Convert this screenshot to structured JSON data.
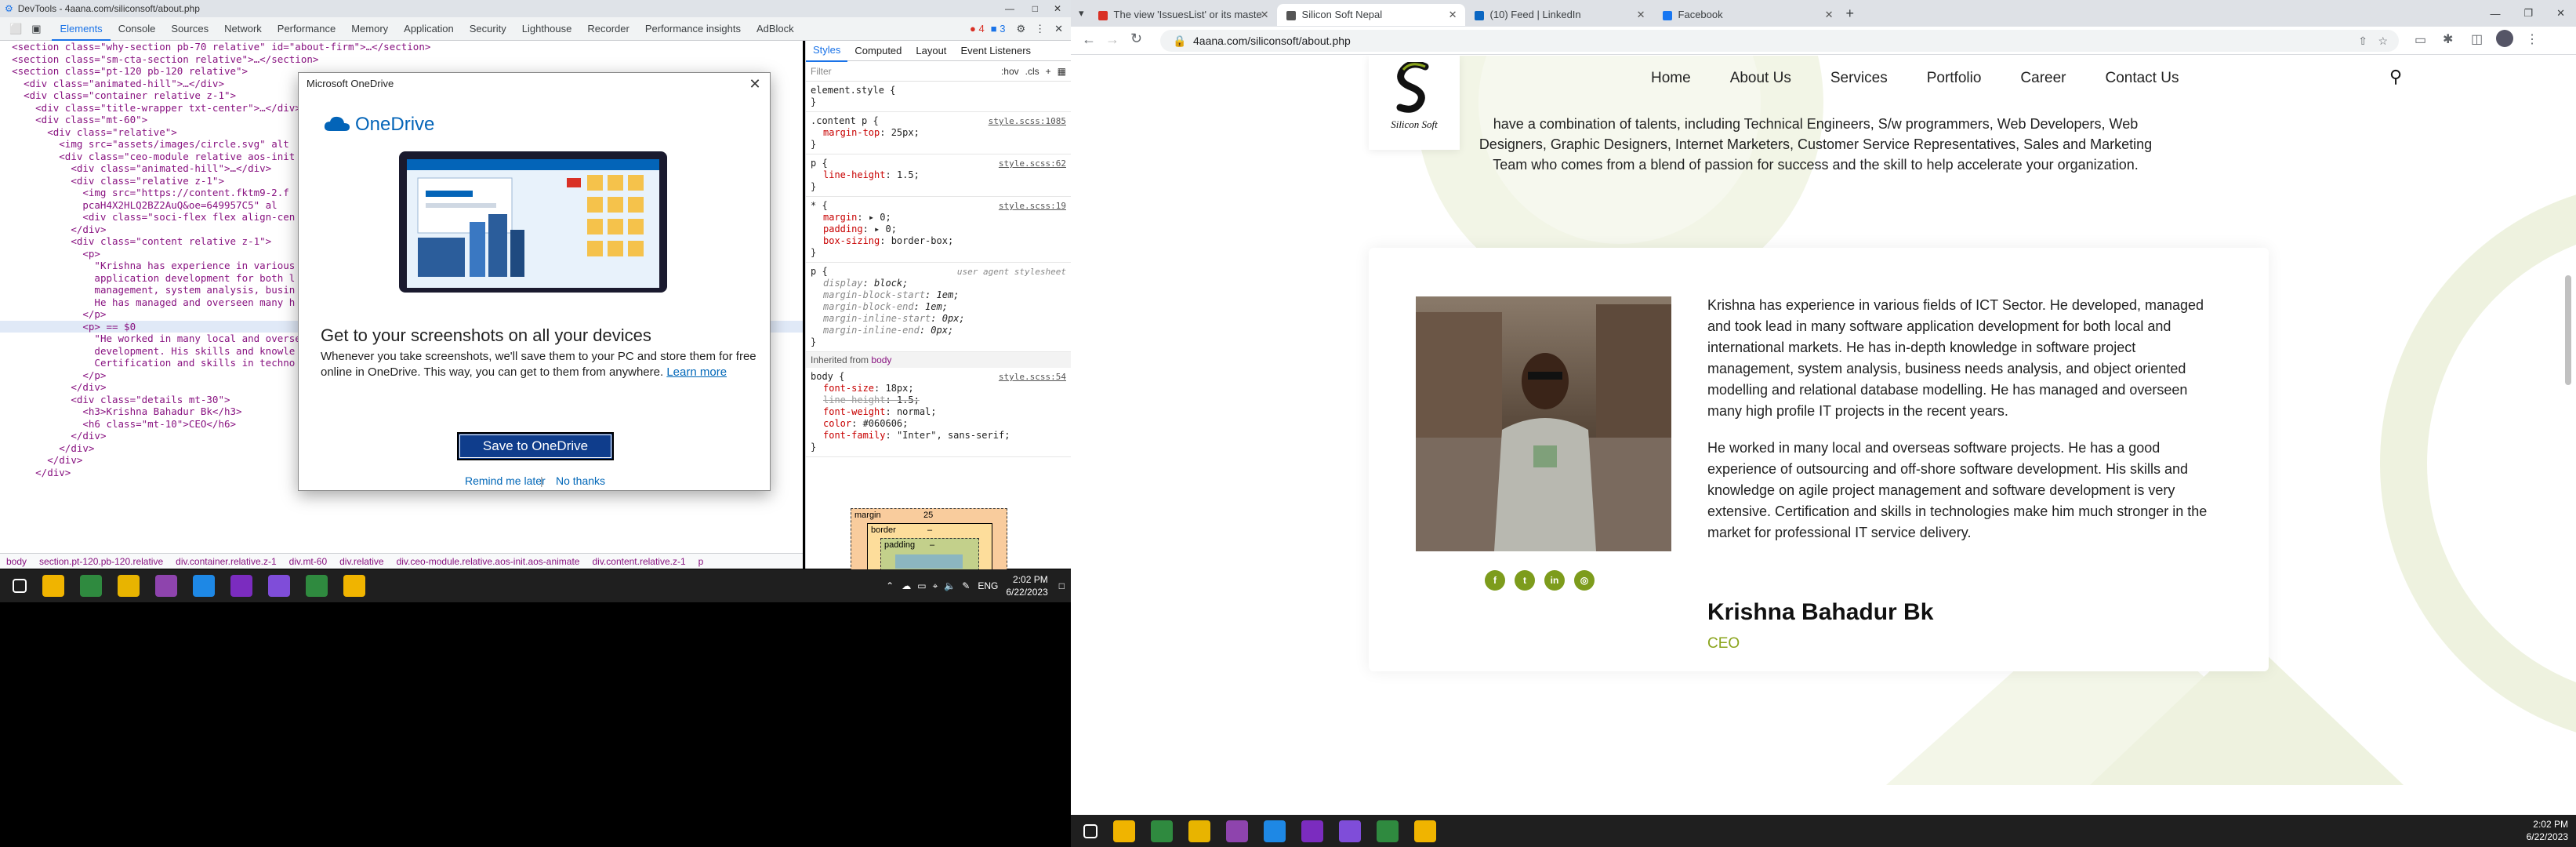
{
  "devtools": {
    "window_title": "DevTools - 4aana.com/siliconsoft/about.php",
    "tabs": [
      "Elements",
      "Console",
      "Sources",
      "Network",
      "Performance",
      "Memory",
      "Application",
      "Security",
      "Lighthouse",
      "Recorder",
      "Performance insights",
      "AdBlock"
    ],
    "active_tab": "Elements",
    "error_count": "4",
    "warning_count": "3",
    "dom_lines": [
      {
        "indent": 1,
        "text": "<section class=\"why-section pb-70 relative\" id=\"about-firm\">…</section>"
      },
      {
        "indent": 1,
        "text": "<section class=\"sm-cta-section relative\">…</section>"
      },
      {
        "indent": 1,
        "text": "<section class=\"pt-120 pb-120 relative\">"
      },
      {
        "indent": 2,
        "text": "<div class=\"animated-hill\">…</div>"
      },
      {
        "indent": 2,
        "text": "<div class=\"container relative z-1\">"
      },
      {
        "indent": 3,
        "text": "<div class=\"title-wrapper txt-center\">…</div>"
      },
      {
        "indent": 3,
        "text": "<div class=\"mt-60\">"
      },
      {
        "indent": 4,
        "text": "<div class=\"relative\">"
      },
      {
        "indent": 5,
        "text": "<img src=\"assets/images/circle.svg\" alt"
      },
      {
        "indent": 5,
        "text": "<div class=\"ceo-module relative aos-init"
      },
      {
        "indent": 6,
        "text": "<div class=\"animated-hill\">…</div>"
      },
      {
        "indent": 6,
        "text": "<div class=\"relative z-1\">"
      },
      {
        "indent": 7,
        "text": "<img src=\"https://content.fktm9-2.f"
      },
      {
        "indent": 7,
        "text": "pcaH4X2HLQ2BZ2AuQ&oe=649957C5\" al"
      },
      {
        "indent": 7,
        "text": "<div class=\"soci-flex flex align-cen"
      },
      {
        "indent": 6,
        "text": "</div>"
      },
      {
        "indent": 6,
        "text": "<div class=\"content relative z-1\">"
      },
      {
        "indent": 7,
        "text": "<p>"
      },
      {
        "indent": 8,
        "text": "\"Krishna has experience in various"
      },
      {
        "indent": 8,
        "text": "application development for both l"
      },
      {
        "indent": 8,
        "text": "management, system analysis, busin"
      },
      {
        "indent": 8,
        "text": "He has managed and overseen many h"
      },
      {
        "indent": 7,
        "text": "</p>"
      },
      {
        "indent": 7,
        "text": "<p> == $0",
        "selected": true
      },
      {
        "indent": 8,
        "text": "\"He worked in many local and overse"
      },
      {
        "indent": 8,
        "text": "development. His skills and knowle"
      },
      {
        "indent": 8,
        "text": "Certification and skills in techno"
      },
      {
        "indent": 7,
        "text": "</p>"
      },
      {
        "indent": 6,
        "text": "</div>"
      },
      {
        "indent": 6,
        "text": "<div class=\"details mt-30\">"
      },
      {
        "indent": 7,
        "text": "<h3>Krishna Bahadur Bk</h3>"
      },
      {
        "indent": 7,
        "text": "<h6 class=\"mt-10\">CEO</h6>"
      },
      {
        "indent": 6,
        "text": "</div>"
      },
      {
        "indent": 5,
        "text": "</div>"
      },
      {
        "indent": 4,
        "text": "</div>"
      },
      {
        "indent": 3,
        "text": "</div>"
      }
    ],
    "breadcrumbs": [
      "body",
      "section.pt-120.pb-120.relative",
      "div.container.relative.z-1",
      "div.mt-60",
      "div.relative",
      "div.ceo-module.relative.aos-init.aos-animate",
      "div.content.relative.z-1",
      "p"
    ],
    "styles_tabs": [
      "Styles",
      "Computed",
      "Layout",
      "Event Listeners"
    ],
    "filter_placeholder": "Filter",
    "filter_toggles": [
      ":hov",
      ".cls"
    ],
    "rules": [
      {
        "selector": "element.style {",
        "source": "",
        "props": []
      },
      {
        "selector": ".content p {",
        "source": "style.scss:1085",
        "props": [
          {
            "name": "margin-top",
            "value": "25px"
          }
        ]
      },
      {
        "selector": "p {",
        "source": "style.scss:62",
        "props": [
          {
            "name": "line-height",
            "value": "1.5"
          }
        ]
      },
      {
        "selector": "* {",
        "source": "style.scss:19",
        "props": [
          {
            "name": "margin",
            "value": "▸ 0"
          },
          {
            "name": "padding",
            "value": "▸ 0"
          },
          {
            "name": "box-sizing",
            "value": "border-box"
          }
        ]
      },
      {
        "selector": "p {",
        "source": "user agent stylesheet",
        "ua": true,
        "props": [
          {
            "name": "display",
            "value": "block"
          },
          {
            "name": "margin-block-start",
            "value": "1em"
          },
          {
            "name": "margin-block-end",
            "value": "1em"
          },
          {
            "name": "margin-inline-start",
            "value": "0px"
          },
          {
            "name": "margin-inline-end",
            "value": "0px"
          }
        ]
      }
    ],
    "inherited_label": "Inherited from",
    "inherited_from": "body",
    "body_rule": {
      "selector": "body {",
      "source": "style.scss:54",
      "props": [
        {
          "name": "font-size",
          "value": "18px"
        },
        {
          "name": "line-height",
          "value": "1.5",
          "strike": true
        },
        {
          "name": "font-weight",
          "value": "normal"
        },
        {
          "name": "color",
          "value": "#060606"
        },
        {
          "name": "font-family",
          "value": "\"Inter\", sans-serif"
        }
      ]
    },
    "boxmodel": {
      "margin_label": "margin",
      "margin_value": "25",
      "border_label": "border",
      "border_value": "–",
      "padding_label": "padding",
      "padding_value": "–"
    }
  },
  "onedrive": {
    "title": "Microsoft OneDrive",
    "brand": "OneDrive",
    "heading": "Get to your screenshots on all your devices",
    "description": "Whenever you take screenshots, we'll save them to your PC and store them for free online in OneDrive. This way, you can get to them from anywhere.",
    "learn_more": "Learn more",
    "save_button": "Save to OneDrive",
    "remind_later": "Remind me later",
    "separator": "|",
    "no_thanks": "No thanks"
  },
  "left_taskbar": {
    "icons": [
      "windows-start",
      "file-explorer",
      "chrome",
      "sticky-notes",
      "visual-studio",
      "vscode",
      "visual-studio-purple",
      "viber",
      "chrome-2",
      "snip"
    ],
    "lang": "ENG",
    "time": "2:02 PM",
    "date": "6/22/2023"
  },
  "browser": {
    "tabs": [
      {
        "title": "The view 'IssuesList' or its maste",
        "icon": "error"
      },
      {
        "title": "Silicon Soft Nepal",
        "icon": "site",
        "active": true
      },
      {
        "title": "(10) Feed | LinkedIn",
        "icon": "linkedin"
      },
      {
        "title": "Facebook",
        "icon": "facebook"
      }
    ],
    "url": "4aana.com/siliconsoft/about.php"
  },
  "site": {
    "logo_text": "Silicon Soft",
    "nav": [
      "Home",
      "About Us",
      "Services",
      "Portfolio",
      "Career",
      "Contact Us"
    ],
    "intro": "have a combination of talents, including Technical Engineers, S/w programmers, Web Developers, Web Designers, Graphic Designers, Internet Marketers, Customer Service Representatives, Sales and Marketing Team who comes from a blend of passion for success and the skill to help accelerate your organization.",
    "bio_p1": "Krishna has experience in various fields of ICT Sector. He developed, managed and took lead in many software application development for both local and international markets. He has in-depth knowledge in software project management, system analysis, business needs analysis, and object oriented modelling and relational database modelling. He has managed and overseen many high profile IT projects in the recent years.",
    "bio_p2": "He worked in many local and overseas software projects. He has a good experience of outsourcing and off-shore software development. His skills and knowledge on agile project management and software development is very extensive. Certification and skills in technologies make him much stronger in the market for professional IT service delivery.",
    "name": "Krishna Bahadur Bk",
    "role": "CEO",
    "socials": [
      {
        "icon": "facebook-icon",
        "glyph": "f"
      },
      {
        "icon": "twitter-icon",
        "glyph": "t"
      },
      {
        "icon": "linkedin-icon",
        "glyph": "in"
      },
      {
        "icon": "instagram-icon",
        "glyph": "◎"
      }
    ],
    "accent_color": "#8aa41c"
  },
  "right_taskbar": {
    "time": "2:02 PM",
    "date": "6/22/2023"
  }
}
